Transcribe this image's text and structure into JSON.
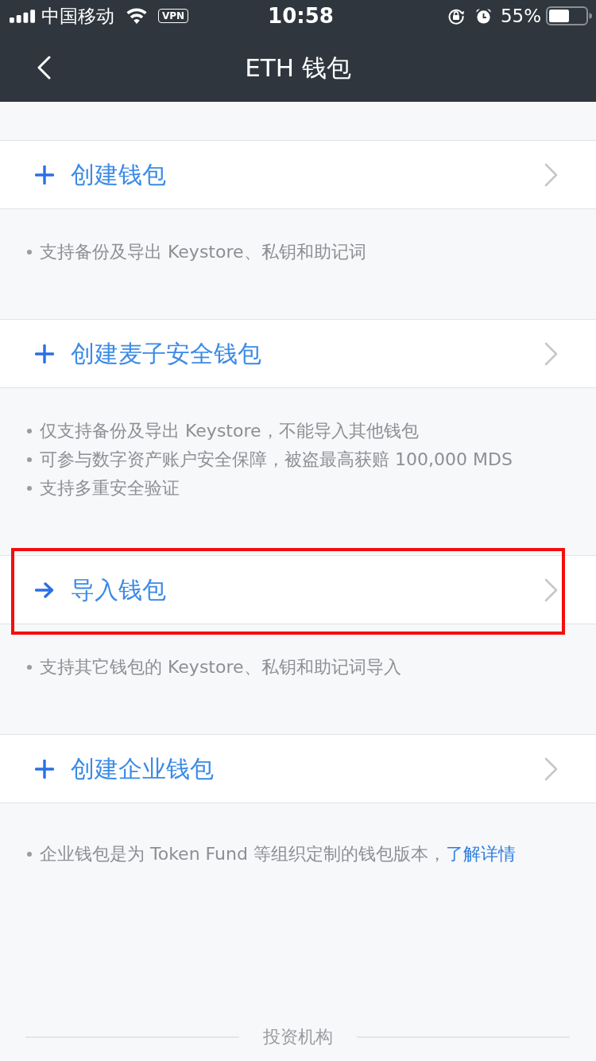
{
  "status_bar": {
    "carrier": "中国移动",
    "vpn": "VPN",
    "time": "10:58",
    "battery_percent": "55%"
  },
  "nav_bar": {
    "title": "ETH 钱包"
  },
  "options": [
    {
      "kind": "create",
      "label": "创建钱包",
      "highlighted": false,
      "notes": [
        {
          "text": "支持备份及导出 Keystore、私钥和助记词"
        }
      ]
    },
    {
      "kind": "create",
      "label": "创建麦子安全钱包",
      "highlighted": false,
      "notes": [
        {
          "text": "仅支持备份及导出 Keystore，不能导入其他钱包"
        },
        {
          "text": "可参与数字资产账户安全保障，被盗最高获赔 100,000 MDS"
        },
        {
          "text": "支持多重安全验证"
        }
      ]
    },
    {
      "kind": "import",
      "label": "导入钱包",
      "highlighted": true,
      "notes": [
        {
          "text": "支持其它钱包的 Keystore、私钥和助记词导入"
        }
      ]
    },
    {
      "kind": "create",
      "label": "创建企业钱包",
      "highlighted": false,
      "notes": [
        {
          "text": "企业钱包是为 Token Fund 等组织定制的钱包版本，",
          "link": "了解详情"
        }
      ]
    }
  ],
  "footer": {
    "divider_label": "投资机构"
  }
}
